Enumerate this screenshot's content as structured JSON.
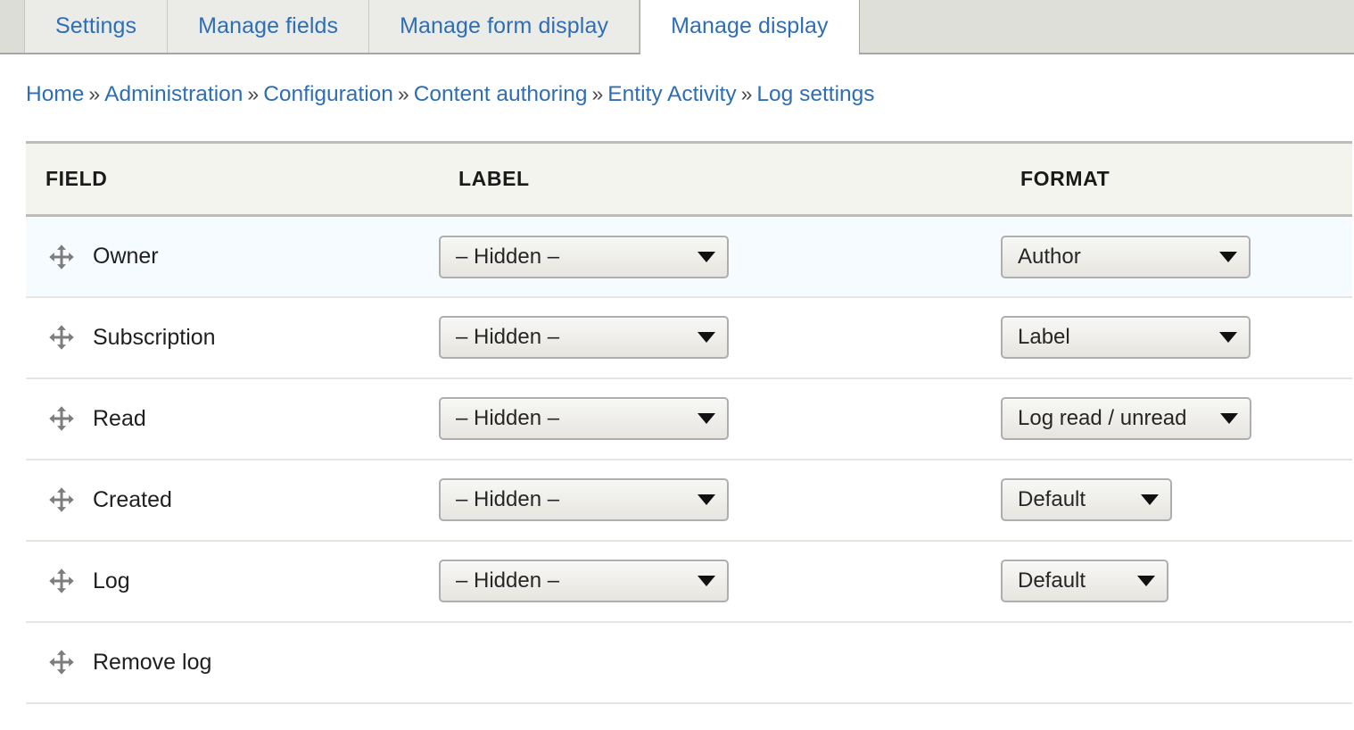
{
  "tabs": [
    {
      "label": "Settings",
      "active": false
    },
    {
      "label": "Manage fields",
      "active": false
    },
    {
      "label": "Manage form display",
      "active": false
    },
    {
      "label": "Manage display",
      "active": true
    }
  ],
  "breadcrumb": {
    "separator": "»",
    "items": [
      "Home",
      "Administration",
      "Configuration",
      "Content authoring",
      "Entity Activity",
      "Log settings"
    ]
  },
  "table": {
    "headers": {
      "field": "FIELD",
      "label": "LABEL",
      "format": "FORMAT"
    },
    "rows": [
      {
        "field": "Owner",
        "label_select": "– Hidden –",
        "format_select": "Author",
        "drag_icon": "move-arrows-icon",
        "highlight": true
      },
      {
        "field": "Subscription",
        "label_select": "– Hidden –",
        "format_select": "Label",
        "drag_icon": "move-arrows-icon",
        "highlight": false
      },
      {
        "field": "Read",
        "label_select": "– Hidden –",
        "format_select": "Log read / unread",
        "drag_icon": "move-arrows-icon",
        "highlight": false
      },
      {
        "field": "Created",
        "label_select": "– Hidden –",
        "format_select": "Default",
        "drag_icon": "move-arrows-icon",
        "highlight": false
      },
      {
        "field": "Log",
        "label_select": "– Hidden –",
        "format_select": "Default",
        "drag_icon": "move-arrows-icon",
        "highlight": false
      },
      {
        "field": "Remove log",
        "label_select": "",
        "format_select": "",
        "drag_icon": "move-arrows-icon",
        "highlight": false
      }
    ]
  },
  "colors": {
    "link": "#2f6eb5",
    "tab_active_bg": "#ffffff",
    "tab_bg": "#ebece7",
    "tabbar_bg": "#dedfd9",
    "header_bg": "#f4f4ef",
    "row_highlight_bg": "#f6fbff",
    "drag_handle": "#7d7d7d",
    "text": "#1f1f1f"
  }
}
